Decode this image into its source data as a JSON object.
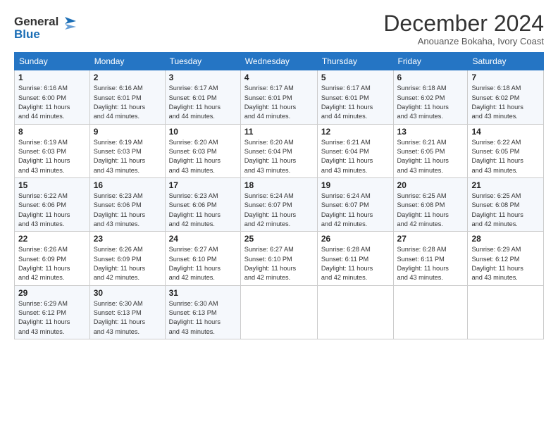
{
  "logo": {
    "line1": "General",
    "line2": "Blue"
  },
  "title": "December 2024",
  "subtitle": "Anouanze Bokaha, Ivory Coast",
  "days_header": [
    "Sunday",
    "Monday",
    "Tuesday",
    "Wednesday",
    "Thursday",
    "Friday",
    "Saturday"
  ],
  "weeks": [
    [
      {
        "day": "1",
        "sunrise": "6:16 AM",
        "sunset": "6:00 PM",
        "daylight": "11 hours and 44 minutes."
      },
      {
        "day": "2",
        "sunrise": "6:16 AM",
        "sunset": "6:01 PM",
        "daylight": "11 hours and 44 minutes."
      },
      {
        "day": "3",
        "sunrise": "6:17 AM",
        "sunset": "6:01 PM",
        "daylight": "11 hours and 44 minutes."
      },
      {
        "day": "4",
        "sunrise": "6:17 AM",
        "sunset": "6:01 PM",
        "daylight": "11 hours and 44 minutes."
      },
      {
        "day": "5",
        "sunrise": "6:17 AM",
        "sunset": "6:01 PM",
        "daylight": "11 hours and 44 minutes."
      },
      {
        "day": "6",
        "sunrise": "6:18 AM",
        "sunset": "6:02 PM",
        "daylight": "11 hours and 43 minutes."
      },
      {
        "day": "7",
        "sunrise": "6:18 AM",
        "sunset": "6:02 PM",
        "daylight": "11 hours and 43 minutes."
      }
    ],
    [
      {
        "day": "8",
        "sunrise": "6:19 AM",
        "sunset": "6:03 PM",
        "daylight": "11 hours and 43 minutes."
      },
      {
        "day": "9",
        "sunrise": "6:19 AM",
        "sunset": "6:03 PM",
        "daylight": "11 hours and 43 minutes."
      },
      {
        "day": "10",
        "sunrise": "6:20 AM",
        "sunset": "6:03 PM",
        "daylight": "11 hours and 43 minutes."
      },
      {
        "day": "11",
        "sunrise": "6:20 AM",
        "sunset": "6:04 PM",
        "daylight": "11 hours and 43 minutes."
      },
      {
        "day": "12",
        "sunrise": "6:21 AM",
        "sunset": "6:04 PM",
        "daylight": "11 hours and 43 minutes."
      },
      {
        "day": "13",
        "sunrise": "6:21 AM",
        "sunset": "6:05 PM",
        "daylight": "11 hours and 43 minutes."
      },
      {
        "day": "14",
        "sunrise": "6:22 AM",
        "sunset": "6:05 PM",
        "daylight": "11 hours and 43 minutes."
      }
    ],
    [
      {
        "day": "15",
        "sunrise": "6:22 AM",
        "sunset": "6:06 PM",
        "daylight": "11 hours and 43 minutes."
      },
      {
        "day": "16",
        "sunrise": "6:23 AM",
        "sunset": "6:06 PM",
        "daylight": "11 hours and 43 minutes."
      },
      {
        "day": "17",
        "sunrise": "6:23 AM",
        "sunset": "6:06 PM",
        "daylight": "11 hours and 42 minutes."
      },
      {
        "day": "18",
        "sunrise": "6:24 AM",
        "sunset": "6:07 PM",
        "daylight": "11 hours and 42 minutes."
      },
      {
        "day": "19",
        "sunrise": "6:24 AM",
        "sunset": "6:07 PM",
        "daylight": "11 hours and 42 minutes."
      },
      {
        "day": "20",
        "sunrise": "6:25 AM",
        "sunset": "6:08 PM",
        "daylight": "11 hours and 42 minutes."
      },
      {
        "day": "21",
        "sunrise": "6:25 AM",
        "sunset": "6:08 PM",
        "daylight": "11 hours and 42 minutes."
      }
    ],
    [
      {
        "day": "22",
        "sunrise": "6:26 AM",
        "sunset": "6:09 PM",
        "daylight": "11 hours and 42 minutes."
      },
      {
        "day": "23",
        "sunrise": "6:26 AM",
        "sunset": "6:09 PM",
        "daylight": "11 hours and 42 minutes."
      },
      {
        "day": "24",
        "sunrise": "6:27 AM",
        "sunset": "6:10 PM",
        "daylight": "11 hours and 42 minutes."
      },
      {
        "day": "25",
        "sunrise": "6:27 AM",
        "sunset": "6:10 PM",
        "daylight": "11 hours and 42 minutes."
      },
      {
        "day": "26",
        "sunrise": "6:28 AM",
        "sunset": "6:11 PM",
        "daylight": "11 hours and 42 minutes."
      },
      {
        "day": "27",
        "sunrise": "6:28 AM",
        "sunset": "6:11 PM",
        "daylight": "11 hours and 43 minutes."
      },
      {
        "day": "28",
        "sunrise": "6:29 AM",
        "sunset": "6:12 PM",
        "daylight": "11 hours and 43 minutes."
      }
    ],
    [
      {
        "day": "29",
        "sunrise": "6:29 AM",
        "sunset": "6:12 PM",
        "daylight": "11 hours and 43 minutes."
      },
      {
        "day": "30",
        "sunrise": "6:30 AM",
        "sunset": "6:13 PM",
        "daylight": "11 hours and 43 minutes."
      },
      {
        "day": "31",
        "sunrise": "6:30 AM",
        "sunset": "6:13 PM",
        "daylight": "11 hours and 43 minutes."
      },
      null,
      null,
      null,
      null
    ]
  ],
  "labels": {
    "sunrise": "Sunrise: ",
    "sunset": "Sunset: ",
    "daylight": "Daylight: "
  }
}
